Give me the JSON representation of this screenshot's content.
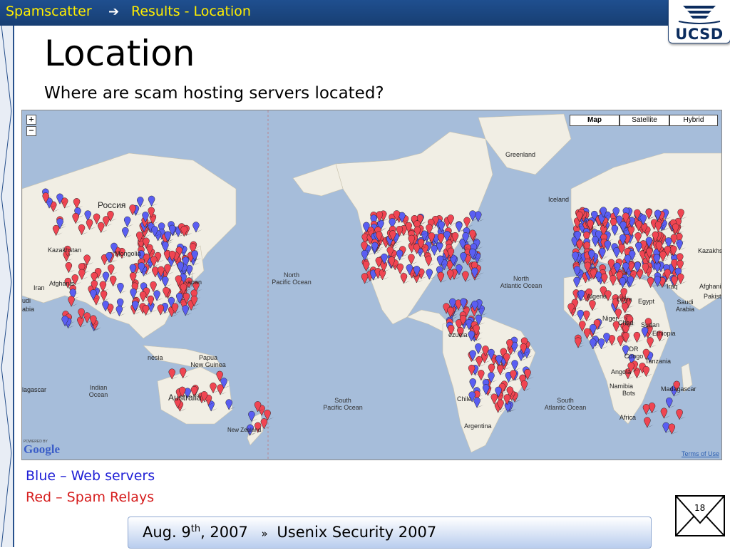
{
  "header": {
    "breadcrumb_root": "Spamscatter",
    "breadcrumb_current": "Results - Location",
    "logo": "UCSD"
  },
  "slide": {
    "title": "Location",
    "subtitle": "Where are scam hosting servers located?"
  },
  "map": {
    "zoom_in": "+",
    "zoom_out": "−",
    "type_buttons": [
      "Map",
      "Satellite",
      "Hybrid"
    ],
    "active_type": "Map",
    "labels": {
      "greenland": "Greenland",
      "iceland": "Iceland",
      "russia": "Россия",
      "kazakhstan": "Kazakhstan",
      "mongolia": "Mongolia",
      "iran": "Iran",
      "afghanistan": "Afghanis",
      "saudi_left": "udi",
      "arabia_left": "abia",
      "japan": "apan",
      "north_pacific": "North\nPacific Ocean",
      "north_atlantic": "North\nAtlantic Ocean",
      "south_pacific": "South\nPacific Ocean",
      "south_atlantic": "South\nAtlantic Ocean",
      "indian": "Indian\nOcean",
      "papua": "Papua\nNew Guinea",
      "indonesia": "nesia",
      "australia": "Australia",
      "new_zealand": "New Zealand",
      "madagascar_left": "lagascar",
      "algeria": "Algeria",
      "libya": "Libya",
      "egypt": "Egypt",
      "iraq": "Iraq",
      "afghanistan_right": "Afghanis",
      "pakistan": "Pakist",
      "saudi_right": "Saudi\nArabia",
      "niger": "Niger",
      "chad": "Chad",
      "sudan": "Sudan",
      "ethiopia": "Ethiopia",
      "dr_congo": "DR\nCongo",
      "tanzania": "Tanzania",
      "angola": "Angola",
      "namibia": "Namibia",
      "botswana": "Bots",
      "madagascar": "Madagascar",
      "south_africa": "Africa",
      "kazakhs_right": "Kazakhs",
      "venezuela": "ezuela",
      "argentina": "Argentina",
      "chile": "Chile"
    },
    "powered_by": "POWERED BY",
    "google": "Google",
    "terms": "Terms of Use",
    "colors": {
      "ocean": "#a6bdda",
      "land": "#f1eee4",
      "web_server_marker": "#5a5ef2",
      "spam_relay_marker": "#f04552"
    }
  },
  "legend": {
    "blue": "Blue – Web servers",
    "blue_color": "#1f1fd6",
    "red": "Red – Spam Relays",
    "red_color": "#d61f1f"
  },
  "footer": {
    "date_prefix": "Aug. 9",
    "date_sup": "th",
    "date_suffix": ", 2007",
    "separator": "»",
    "venue": "Usenix Security 2007"
  },
  "page_number": "18"
}
